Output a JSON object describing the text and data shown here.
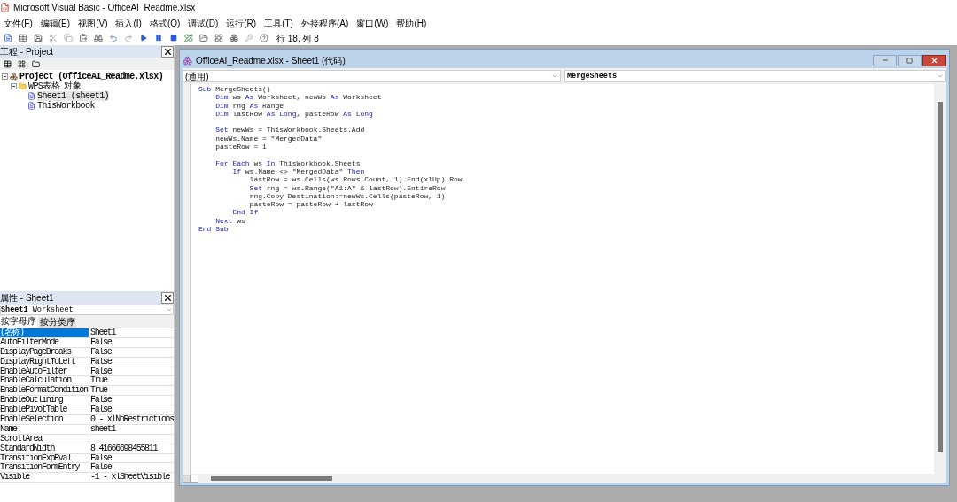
{
  "window": {
    "title": "Microsoft Visual Basic - OfficeAI_Readme.xlsx"
  },
  "menu": [
    "文件(F)",
    "编辑(E)",
    "视图(V)",
    "插入(I)",
    "格式(O)",
    "调试(D)",
    "运行(R)",
    "工具(T)",
    "外接程序(A)",
    "窗口(W)",
    "帮助(H)"
  ],
  "toolbar": {
    "position": "行 18, 列 8"
  },
  "project_pane": {
    "title": "工程 - Project",
    "tree": [
      {
        "label": "Project (OfficeAI_Readme.xlsx)",
        "kind": "project",
        "selected": false,
        "children": [
          {
            "label": "WPS表格 对象",
            "kind": "folder",
            "selected": false,
            "children": [
              {
                "label": "Sheet1 (sheet1)",
                "kind": "sheet",
                "selected": true
              },
              {
                "label": "ThisWorkbook",
                "kind": "sheet",
                "selected": false
              }
            ]
          }
        ]
      }
    ]
  },
  "properties_pane": {
    "title": "属性 - Sheet1",
    "object": {
      "name": "Sheet1",
      "type": "Worksheet"
    },
    "tabs": [
      {
        "label": "按字母序",
        "selected": true
      },
      {
        "label": "按分类序",
        "selected": false
      }
    ],
    "rows": [
      {
        "name": "(名称)",
        "value": "Sheet1",
        "selected": true
      },
      {
        "name": "AutoFilterMode",
        "value": "False",
        "selected": false
      },
      {
        "name": "DisplayPageBreaks",
        "value": "False",
        "selected": false
      },
      {
        "name": "DisplayRightToLeft",
        "value": "False",
        "selected": false
      },
      {
        "name": "EnableAutoFilter",
        "value": "False",
        "selected": false
      },
      {
        "name": "EnableCalculation",
        "value": "True",
        "selected": false
      },
      {
        "name": "EnableFormatCondition",
        "value": "True",
        "selected": false
      },
      {
        "name": "EnableOutlining",
        "value": "False",
        "selected": false
      },
      {
        "name": "EnablePivotTable",
        "value": "False",
        "selected": false
      },
      {
        "name": "EnableSelection",
        "value": "0 - xlNoRestrictions",
        "selected": false
      },
      {
        "name": "Name",
        "value": "sheet1",
        "selected": false
      },
      {
        "name": "ScrollArea",
        "selected": false
      },
      {
        "name": "StandardWidth",
        "value": "8.41666698455811",
        "selected": false
      },
      {
        "name": "TransitionExpEval",
        "value": "False",
        "selected": false
      },
      {
        "name": "TransitionFormEntry",
        "value": "False",
        "selected": false
      },
      {
        "name": "Visible",
        "value": "-1 - xlSheetVisible",
        "selected": false
      }
    ]
  },
  "code_window": {
    "title": "OfficeAI_Readme.xlsx - Sheet1 (代码)",
    "object_list": "(通用)",
    "procedure_list": "MergeSheets",
    "lines": [
      {
        "kind": "code",
        "segments": [
          {
            "text": "Sub",
            "kind": "keyword"
          },
          {
            "text": " MergeSheets()",
            "kind": "plain"
          }
        ]
      },
      {
        "kind": "code",
        "segments": [
          {
            "text": "    Dim",
            "kind": "keyword"
          },
          {
            "text": " ws ",
            "kind": "plain"
          },
          {
            "text": "As",
            "kind": "keyword"
          },
          {
            "text": " Worksheet, newWs ",
            "kind": "plain"
          },
          {
            "text": "As",
            "kind": "keyword"
          },
          {
            "text": " Worksheet",
            "kind": "plain"
          }
        ]
      },
      {
        "kind": "code",
        "segments": [
          {
            "text": "    Dim",
            "kind": "keyword"
          },
          {
            "text": " rng ",
            "kind": "plain"
          },
          {
            "text": "As",
            "kind": "keyword"
          },
          {
            "text": " Range",
            "kind": "plain"
          }
        ]
      },
      {
        "kind": "code",
        "segments": [
          {
            "text": "    Dim",
            "kind": "keyword"
          },
          {
            "text": " lastRow ",
            "kind": "plain"
          },
          {
            "text": "As Long",
            "kind": "keyword"
          },
          {
            "text": ", pasteRow ",
            "kind": "plain"
          },
          {
            "text": "As Long",
            "kind": "keyword"
          }
        ]
      },
      {
        "kind": "blank"
      },
      {
        "kind": "code",
        "segments": [
          {
            "text": "    Set",
            "kind": "keyword"
          },
          {
            "text": " newWs = ThisWorkbook.Sheets.Add",
            "kind": "plain"
          }
        ]
      },
      {
        "kind": "code",
        "segments": [
          {
            "text": "    newWs.Name = \"MergedData\"",
            "kind": "plain"
          }
        ]
      },
      {
        "kind": "code",
        "segments": [
          {
            "text": "    pasteRow = 1",
            "kind": "plain"
          }
        ]
      },
      {
        "kind": "blank"
      },
      {
        "kind": "code",
        "segments": [
          {
            "text": "    For Each",
            "kind": "keyword"
          },
          {
            "text": " ws ",
            "kind": "plain"
          },
          {
            "text": "In",
            "kind": "keyword"
          },
          {
            "text": " ThisWorkbook.Sheets",
            "kind": "plain"
          }
        ]
      },
      {
        "kind": "code",
        "segments": [
          {
            "text": "        If",
            "kind": "keyword"
          },
          {
            "text": " ws.Name <> \"MergedData\" ",
            "kind": "plain"
          },
          {
            "text": "Then",
            "kind": "keyword"
          }
        ]
      },
      {
        "kind": "code",
        "segments": [
          {
            "text": "            lastRow = ws.Cells(ws.Rows.Count, 1).End(xlUp).Row",
            "kind": "plain"
          }
        ]
      },
      {
        "kind": "code",
        "segments": [
          {
            "text": "            Set",
            "kind": "keyword"
          },
          {
            "text": " rng = ws.Range(\"A1:A\" & lastRow).EntireRow",
            "kind": "plain"
          }
        ]
      },
      {
        "kind": "code",
        "segments": [
          {
            "text": "            rng.Copy Destination:=newWs.Cells(pasteRow, 1)",
            "kind": "plain"
          }
        ]
      },
      {
        "kind": "code",
        "segments": [
          {
            "text": "            pasteRow = pasteRow + lastRow",
            "kind": "plain"
          }
        ]
      },
      {
        "kind": "code",
        "segments": [
          {
            "text": "        End If",
            "kind": "keyword"
          }
        ]
      },
      {
        "kind": "code",
        "segments": [
          {
            "text": "    Next",
            "kind": "keyword"
          },
          {
            "text": " ws",
            "kind": "plain"
          }
        ]
      },
      {
        "kind": "code",
        "segments": [
          {
            "text": "End Sub",
            "kind": "keyword"
          }
        ]
      }
    ]
  }
}
